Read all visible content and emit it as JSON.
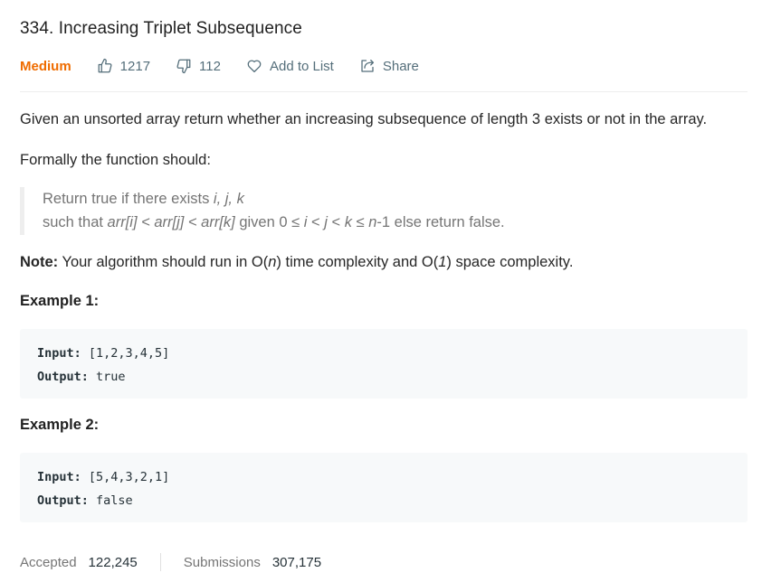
{
  "problem": {
    "title": "334. Increasing Triplet Subsequence",
    "difficulty": "Medium",
    "likes": "1217",
    "dislikes": "112",
    "add_to_list": "Add to List",
    "share": "Share"
  },
  "description": {
    "intro": "Given an unsorted array return whether an increasing subsequence of length 3 exists or not in the array.",
    "formally": "Formally the function should:",
    "quote_line1_prefix": "Return true if there exists ",
    "quote_line1_vars": "i, j, k",
    "quote_line2_prefix": "such that ",
    "quote_line2_expr": "arr[i] < arr[j] < arr[k]",
    "quote_line2_mid": " given 0 ≤ ",
    "quote_line2_i": "i",
    "quote_line2_lt1": " < ",
    "quote_line2_j": "j",
    "quote_line2_lt2": " < ",
    "quote_line2_k": "k",
    "quote_line2_le": " ≤ ",
    "quote_line2_n": "n",
    "quote_line2_suffix": "-1 else return false.",
    "note_label": "Note:",
    "note_text_a": " Your algorithm should run in O(",
    "note_n": "n",
    "note_text_b": ") time complexity and O(",
    "note_one": "1",
    "note_text_c": ") space complexity."
  },
  "examples": [
    {
      "heading": "Example 1:",
      "input_label": "Input:",
      "input_value": " [1,2,3,4,5]",
      "output_label": "Output:",
      "output_value": " true"
    },
    {
      "heading": "Example 2:",
      "input_label": "Input:",
      "input_value": " [5,4,3,2,1]",
      "output_label": "Output:",
      "output_value": " false"
    }
  ],
  "stats": {
    "accepted_label": "Accepted",
    "accepted_value": "122,245",
    "submissions_label": "Submissions",
    "submissions_value": "307,175"
  },
  "colors": {
    "difficulty_medium": "#ef6c00",
    "meta_text": "#546e7a",
    "code_background": "#f7f9fa"
  },
  "icons": {
    "like": "thumbs-up-icon",
    "dislike": "thumbs-down-icon",
    "add_to_list": "heart-icon",
    "share": "share-icon"
  }
}
